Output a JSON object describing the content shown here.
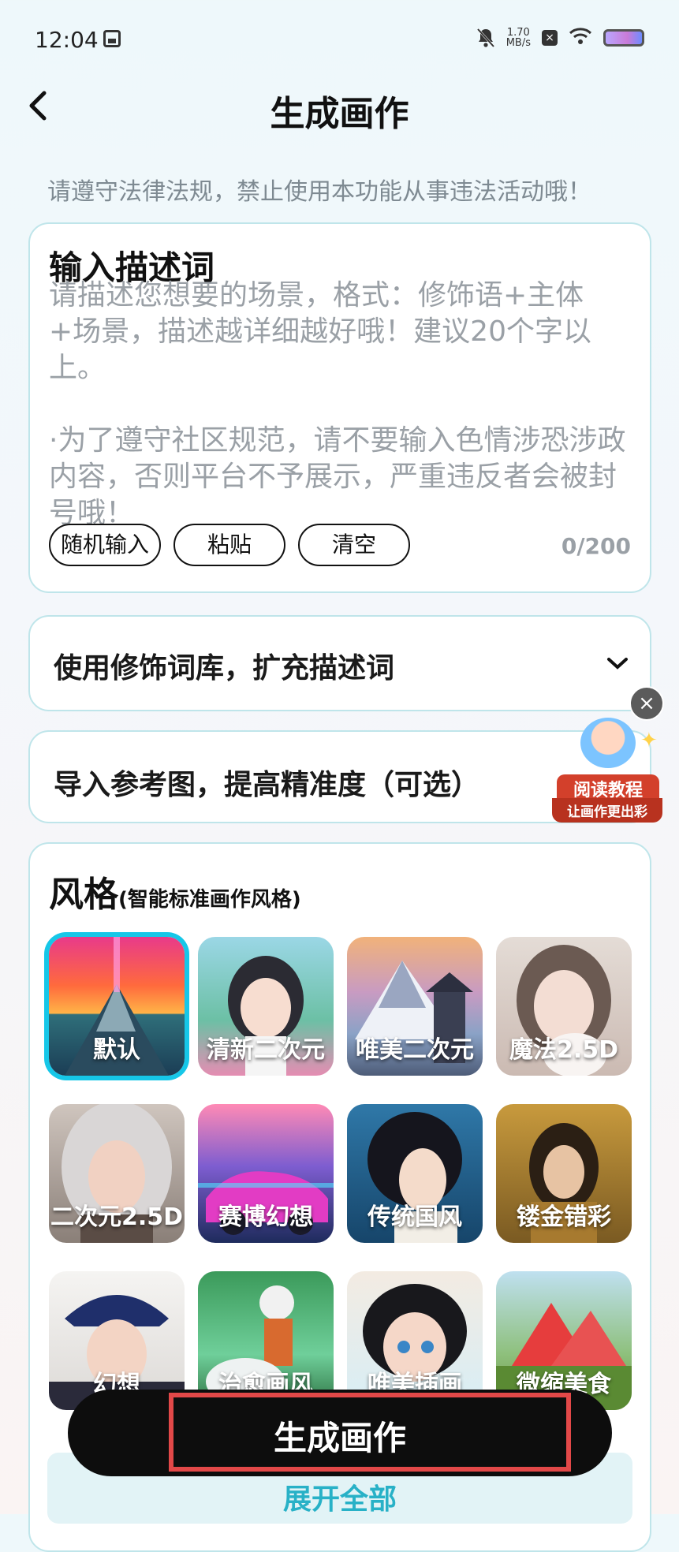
{
  "status": {
    "time": "12:04",
    "speed_value": "1.70",
    "speed_unit": "MB/s"
  },
  "header": {
    "title": "生成画作"
  },
  "notice": "请遵守法律法规，禁止使用本功能从事违法活动哦！",
  "description": {
    "title": "输入描述词",
    "placeholder": "请描述您想要的场景，格式：修饰语+主体+场景，描述越详细越好哦！建议20个字以上。\n\n·为了遵守社区规范，请不要输入色情涉恐涉政内容，否则平台不予展示，严重违反者会被封号哦！",
    "buttons": [
      "随机输入",
      "粘贴",
      "清空"
    ],
    "counter": "0/200"
  },
  "modifier": {
    "label": "使用修饰词库，扩充描述词"
  },
  "reference": {
    "label": "导入参考图，提高精准度（可选）"
  },
  "style": {
    "title": "风格",
    "subtitle": "(智能标准画作风格)",
    "items": [
      {
        "label": "默认",
        "selected": true
      },
      {
        "label": "清新二次元"
      },
      {
        "label": "唯美二次元"
      },
      {
        "label": "魔法2.5D"
      },
      {
        "label": "二次元2.5D"
      },
      {
        "label": "赛博幻想"
      },
      {
        "label": "传统国风"
      },
      {
        "label": "镂金错彩"
      },
      {
        "label": "幻想"
      },
      {
        "label": "治愈画风"
      },
      {
        "label": "唯美插画"
      },
      {
        "label": "微缩美食"
      }
    ]
  },
  "expand_label": "展开全部",
  "generate_label": "生成画作",
  "tutorial": {
    "line1": "阅读教程",
    "line2": "让画作更出彩"
  }
}
